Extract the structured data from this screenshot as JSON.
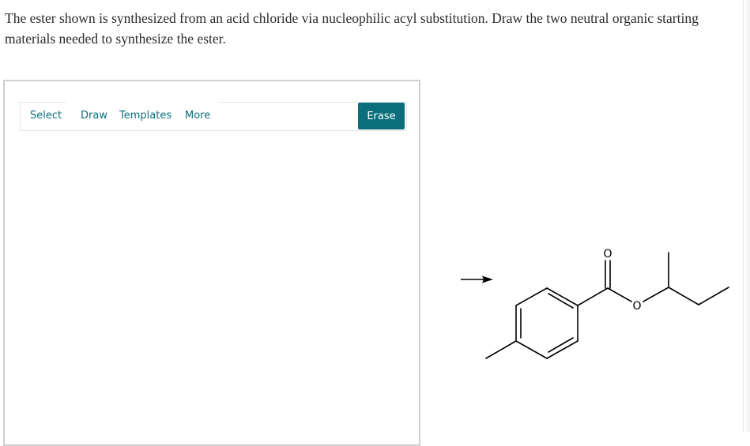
{
  "question": {
    "text": "The ester shown is synthesized from an acid chloride via nucleophilic acyl substitution. Draw the two neutral organic starting materials needed to synthesize the ester."
  },
  "toolbar": {
    "tabs": [
      {
        "label": "Select"
      },
      {
        "label": "Draw"
      },
      {
        "label": "Templates"
      },
      {
        "label": "More"
      }
    ],
    "erase_label": "Erase",
    "accent_color": "#0b6e7a"
  },
  "scheme": {
    "atoms": {
      "carbonyl_oxygen": "O",
      "ester_oxygen": "O"
    }
  }
}
